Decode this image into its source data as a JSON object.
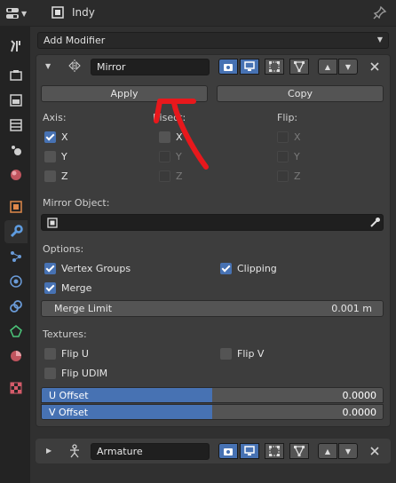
{
  "header": {
    "object_name": "Indy"
  },
  "toolbar": {
    "add_modifier_label": "Add Modifier"
  },
  "mirror_modifier": {
    "name": "Mirror",
    "apply_label": "Apply",
    "copy_label": "Copy",
    "axis_label": "Axis:",
    "bisect_label": "Bisect:",
    "flip_label": "Flip:",
    "axis": {
      "x": "X",
      "y": "Y",
      "z": "Z"
    },
    "axis_checked": {
      "x": true,
      "y": false,
      "z": false
    },
    "mirror_object_label": "Mirror Object:",
    "options_label": "Options:",
    "vertex_groups_label": "Vertex Groups",
    "clipping_label": "Clipping",
    "merge_label": "Merge",
    "merge_limit_label": "Merge Limit",
    "merge_limit_value": "0.001 m",
    "textures_label": "Textures:",
    "flip_u_label": "Flip U",
    "flip_v_label": "Flip V",
    "flip_udim_label": "Flip UDIM",
    "u_offset_label": "U Offset",
    "u_offset_value": "0.0000",
    "v_offset_label": "V Offset",
    "v_offset_value": "0.0000",
    "offset_fill_fraction": 0.5
  },
  "armature_modifier": {
    "name": "Armature"
  },
  "colors": {
    "accent": "#4772b3",
    "annotation_arrow": "#e8181c",
    "panel": "#3d3d3d",
    "background": "#303030"
  }
}
